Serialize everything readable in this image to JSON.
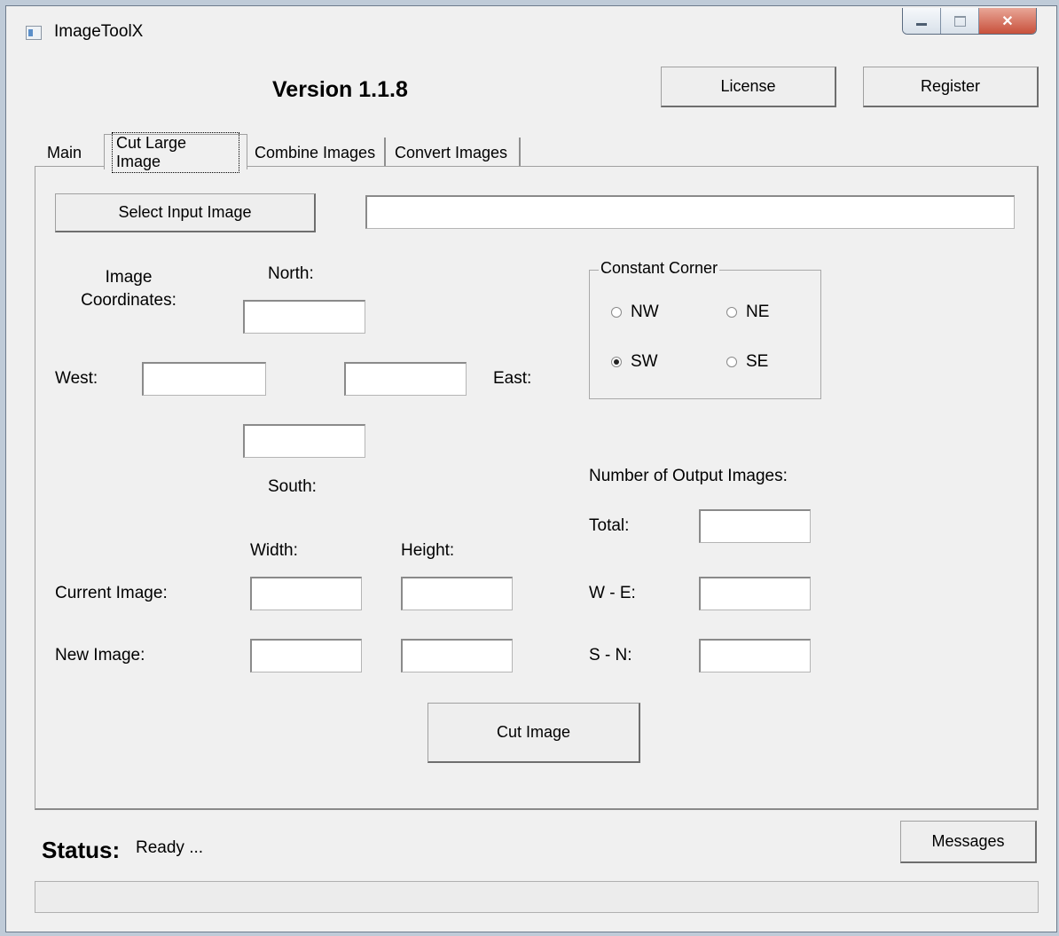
{
  "window": {
    "title": "ImageToolX"
  },
  "header": {
    "version": "Version 1.1.8",
    "license_label": "License",
    "register_label": "Register"
  },
  "tabs": [
    {
      "label": "Main",
      "active": false
    },
    {
      "label": "Cut Large Image",
      "active": true
    },
    {
      "label": "Combine Images",
      "active": false
    },
    {
      "label": "Convert Images",
      "active": false
    }
  ],
  "cut": {
    "select_label": "Select Input Image",
    "input_path": "",
    "coords_label": "Image\nCoordinates:",
    "north_label": "North:",
    "west_label": "West:",
    "east_label": "East:",
    "south_label": "South:",
    "north": "",
    "west": "",
    "east": "",
    "south": "",
    "corner": {
      "legend": "Constant Corner",
      "options": [
        "NW",
        "NE",
        "SW",
        "SE"
      ],
      "selected": "SW"
    },
    "width_label": "Width:",
    "height_label": "Height:",
    "current_label": "Current Image:",
    "new_label": "New Image:",
    "current_width": "",
    "current_height": "",
    "new_width": "",
    "new_height": "",
    "output_label": "Number of Output Images:",
    "total_label": "Total:",
    "we_label": "W - E:",
    "sn_label": "S - N:",
    "total": "",
    "we": "",
    "sn": "",
    "cut_label": "Cut Image"
  },
  "status": {
    "label": "Status:",
    "text": "Ready ...",
    "messages_label": "Messages",
    "progress": 0
  },
  "colors": {
    "window_bg": "#f0f0f0",
    "close_button": "#c8503b",
    "desktop": "#bfcbd8"
  }
}
